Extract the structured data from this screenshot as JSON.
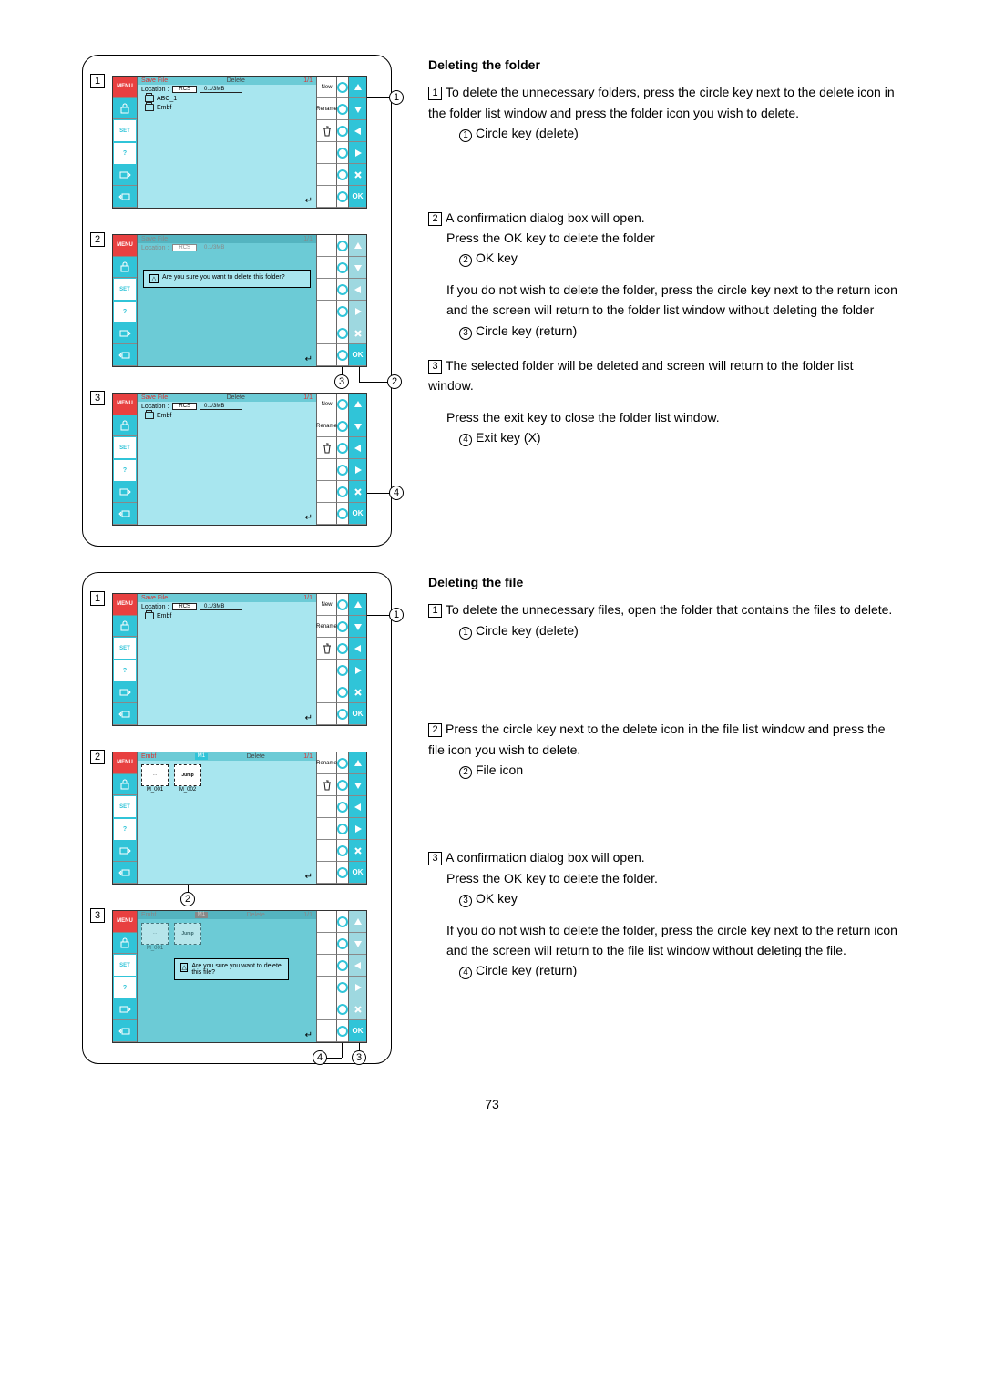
{
  "page_number": "73",
  "section1": {
    "heading": "Deleting the folder",
    "step1": {
      "num": "1",
      "text": "To delete the unnecessary folders, press the circle key next to the delete icon in the folder list window and press the folder icon you wish to delete.",
      "sub_num": "1",
      "sub_text": "Circle key (delete)"
    },
    "step2": {
      "num": "2",
      "text": "A confirmation dialog box will open.",
      "text2": "Press the OK key to delete the folder",
      "sub_num": "2",
      "sub_text": "OK key",
      "text3": "If you do not wish to delete the folder, press the circle key next to the return icon and the screen will return to the folder list window without deleting the folder",
      "sub_num2": "3",
      "sub_text2": "Circle key (return)"
    },
    "step3": {
      "num": "3",
      "text": "The selected folder will be deleted and screen will return to the folder list window.",
      "text2": "Press the exit key to close the folder list window.",
      "sub_num": "4",
      "sub_text": "Exit key (X)"
    }
  },
  "section2": {
    "heading": "Deleting the file",
    "step1": {
      "num": "1",
      "text": "To delete the unnecessary files, open the folder that contains the files to delete.",
      "sub_num": "1",
      "sub_text": "Circle key (delete)"
    },
    "step2": {
      "num": "2",
      "text": "Press the circle key next to the delete icon in the file list window and press the file icon you wish to delete.",
      "sub_num": "2",
      "sub_text": "File icon"
    },
    "step3": {
      "num": "3",
      "text": "A confirmation dialog box will open.",
      "text2": "Press the OK key to delete the folder.",
      "sub_num": "3",
      "sub_text": "OK key",
      "text3": "If you do not wish to delete the folder, press the circle key next to the return icon and the screen will return to the file list window without deleting the file.",
      "sub_num2": "4",
      "sub_text2": "Circle key (return)"
    }
  },
  "figA": {
    "callout1": "1",
    "callout2": "2",
    "callout3": "3",
    "callout4": "4",
    "screen1": {
      "title": "Save File",
      "delete": "Delete",
      "page": "1/1",
      "location": "Location :",
      "loc_box": "RCS",
      "size": "0.1/3MB",
      "folder1": "ABC_1",
      "folder2": "Embf",
      "new": "New",
      "rename": "Rename"
    },
    "screen2": {
      "title": "Save File",
      "page": "1/1",
      "location": "Location :",
      "loc_box": "RCS",
      "size": "0.1/3MB",
      "dialog": "Are you sure you want to delete this folder?"
    },
    "screen3": {
      "title": "Save File",
      "delete": "Delete",
      "page": "1/1",
      "location": "Location :",
      "loc_box": "RCS",
      "size": "0.1/3MB",
      "folder1": "Embf",
      "new": "New",
      "rename": "Rename"
    }
  },
  "figB": {
    "callout1": "1",
    "callout2": "2",
    "callout3": "3",
    "callout4": "4",
    "screen1": {
      "title": "Save File",
      "page": "1/1",
      "location": "Location :",
      "loc_box": "RCS",
      "size": "0.1/3MB",
      "folder1": "Embf",
      "new": "New",
      "rename": "Rename"
    },
    "screen2": {
      "title": "Embf",
      "m1": "M1",
      "delete": "Delete",
      "page": "1/1",
      "jump": "Jump",
      "file1": "M_001",
      "file2": "M_002",
      "rename": "Rename"
    },
    "screen3": {
      "title": "Embf",
      "m1": "M1",
      "delete": "Delete",
      "page": "1/1",
      "jump": "Jump",
      "file1": "M_001",
      "dialog": "Are you sure you want to delete this file?"
    }
  },
  "labels": {
    "menu": "MENU",
    "set": "SET",
    "q": "?",
    "ok": "OK"
  }
}
